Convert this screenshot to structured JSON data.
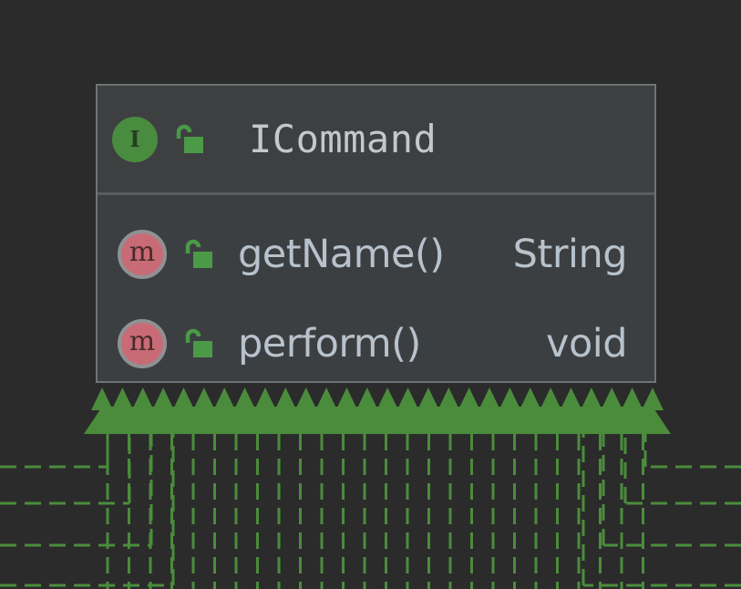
{
  "diagram": {
    "class": {
      "stereotype_icon": "interface-icon",
      "stereotype_letter": "I",
      "visibility_icon": "public-lock-icon",
      "name": "ICommand",
      "methods": [
        {
          "icon": "method-icon",
          "icon_letter": "m",
          "visibility_icon": "public-lock-icon",
          "name": "getName()",
          "return_type": "String"
        },
        {
          "icon": "method-icon",
          "icon_letter": "m",
          "visibility_icon": "public-lock-icon",
          "name": "perform()",
          "return_type": "void"
        }
      ]
    },
    "colors": {
      "background": "#2b2b2b",
      "class_fill": "#3c3f41",
      "class_border": "#6f7375",
      "arrow_green": "#4b8c3c",
      "method_badge": "#c86b76",
      "interface_badge": "#4a8c3f"
    }
  }
}
